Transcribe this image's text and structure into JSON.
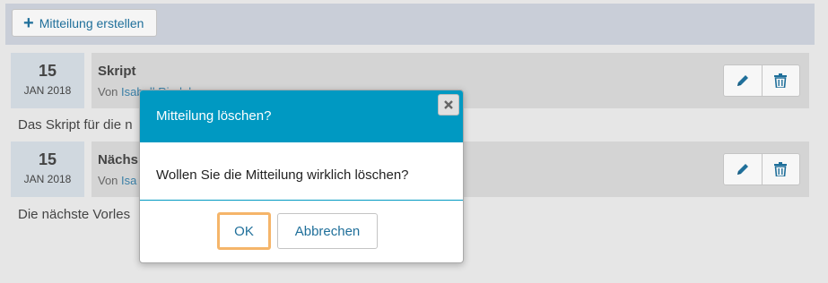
{
  "toolbar": {
    "create_label": "Mitteilung erstellen"
  },
  "messages": [
    {
      "day": "15",
      "month": "JAN 2018",
      "title": "Skript",
      "author_prefix": "Von",
      "author": "Isabell Riedel",
      "text": "Das Skript für die n"
    },
    {
      "day": "15",
      "month": "JAN 2018",
      "title": "Nächs",
      "author_prefix": "Von",
      "author": "Isa",
      "text": "Die nächste Vorles"
    }
  ],
  "dialog": {
    "title": "Mitteilung löschen?",
    "message": "Wollen Sie die Mitteilung wirklich löschen?",
    "ok_label": "OK",
    "cancel_label": "Abbrechen"
  },
  "colors": {
    "accent": "#0099c2",
    "link": "#1f6f9a",
    "focus_outline": "#f5b56a"
  }
}
